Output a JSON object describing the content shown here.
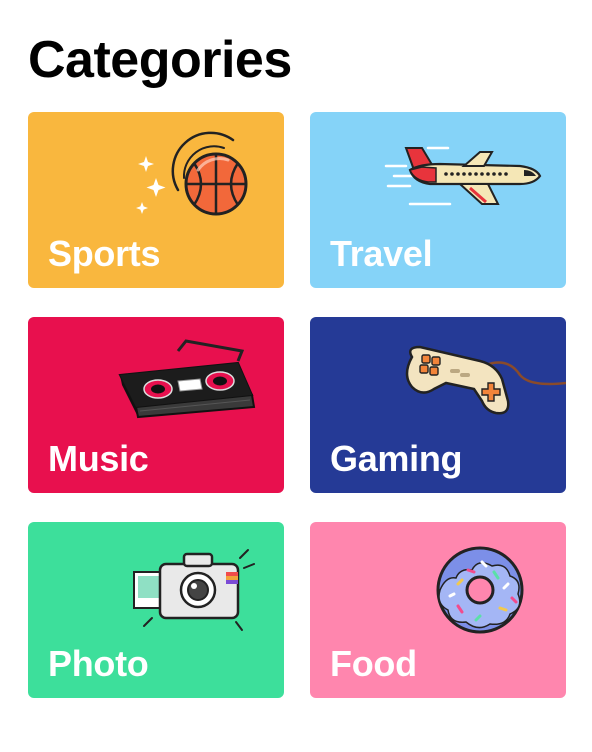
{
  "page": {
    "title": "Categories"
  },
  "categories": [
    {
      "label": "Sports",
      "color": "#F9B73E",
      "icon": "basketball-icon"
    },
    {
      "label": "Travel",
      "color": "#85D3F8",
      "icon": "airplane-icon"
    },
    {
      "label": "Music",
      "color": "#E8104E",
      "icon": "boombox-icon"
    },
    {
      "label": "Gaming",
      "color": "#253A96",
      "icon": "gamepad-icon"
    },
    {
      "label": "Photo",
      "color": "#3DDF9B",
      "icon": "camera-icon"
    },
    {
      "label": "Food",
      "color": "#FF86AE",
      "icon": "donut-icon"
    }
  ]
}
